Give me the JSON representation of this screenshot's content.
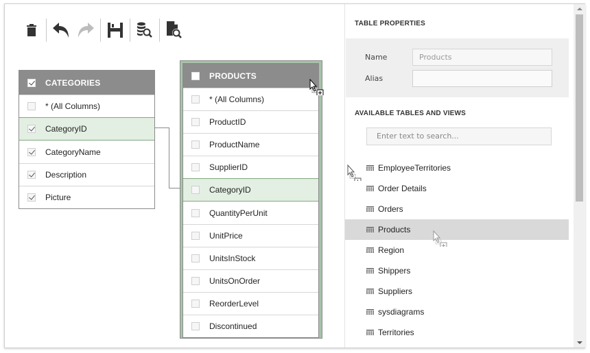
{
  "toolbar": {
    "buttons": [
      {
        "name": "delete",
        "icon": "trash-icon",
        "enabled": true
      },
      {
        "name": "undo",
        "icon": "undo-icon",
        "enabled": true
      },
      {
        "name": "redo",
        "icon": "redo-icon",
        "enabled": false
      },
      {
        "name": "save",
        "icon": "save-icon",
        "enabled": true
      },
      {
        "name": "data-preview",
        "icon": "database-search-icon",
        "enabled": true
      },
      {
        "name": "sql-preview",
        "icon": "document-search-icon",
        "enabled": true
      }
    ]
  },
  "tables": {
    "categories": {
      "title": "CATEGORIES",
      "header_checked": true,
      "columns": [
        {
          "label": "* (All Columns)",
          "checked": false,
          "selected": false
        },
        {
          "label": "CategoryID",
          "checked": true,
          "selected": true
        },
        {
          "label": "CategoryName",
          "checked": true,
          "selected": false
        },
        {
          "label": "Description",
          "checked": true,
          "selected": false
        },
        {
          "label": "Picture",
          "checked": true,
          "selected": false
        }
      ]
    },
    "products": {
      "title": "PRODUCTS",
      "header_checked": false,
      "columns": [
        {
          "label": "* (All Columns)",
          "checked": false,
          "selected": false
        },
        {
          "label": "ProductID",
          "checked": false,
          "selected": false
        },
        {
          "label": "ProductName",
          "checked": false,
          "selected": false
        },
        {
          "label": "SupplierID",
          "checked": false,
          "selected": false
        },
        {
          "label": "CategoryID",
          "checked": false,
          "selected": true
        },
        {
          "label": "QuantityPerUnit",
          "checked": false,
          "selected": false
        },
        {
          "label": "UnitPrice",
          "checked": false,
          "selected": false
        },
        {
          "label": "UnitsInStock",
          "checked": false,
          "selected": false
        },
        {
          "label": "UnitsOnOrder",
          "checked": false,
          "selected": false
        },
        {
          "label": "ReorderLevel",
          "checked": false,
          "selected": false
        },
        {
          "label": "Discontinued",
          "checked": false,
          "selected": false
        }
      ]
    }
  },
  "relation": {
    "from": "Categories.CategoryID",
    "to": "Products.CategoryID"
  },
  "panel": {
    "table_properties_title": "TABLE PROPERTIES",
    "name_label": "Name",
    "name_value": "Products",
    "alias_label": "Alias",
    "alias_value": "",
    "available_title": "AVAILABLE TABLES AND VIEWS",
    "search_placeholder": "Enter text to search...",
    "items": [
      {
        "label": "EmployeeTerritories",
        "highlighted": false
      },
      {
        "label": "Order Details",
        "highlighted": false
      },
      {
        "label": "Orders",
        "highlighted": false
      },
      {
        "label": "Products",
        "highlighted": true
      },
      {
        "label": "Region",
        "highlighted": false
      },
      {
        "label": "Shippers",
        "highlighted": false
      },
      {
        "label": "Suppliers",
        "highlighted": false
      },
      {
        "label": "sysdiagrams",
        "highlighted": false
      },
      {
        "label": "Territories",
        "highlighted": false
      }
    ]
  },
  "colors": {
    "header_bg": "#8c8c8c",
    "selected_row_bg": "#e2efe2",
    "selected_table_border": "#a8c3a8",
    "highlight_item_bg": "#d9d9d9"
  }
}
